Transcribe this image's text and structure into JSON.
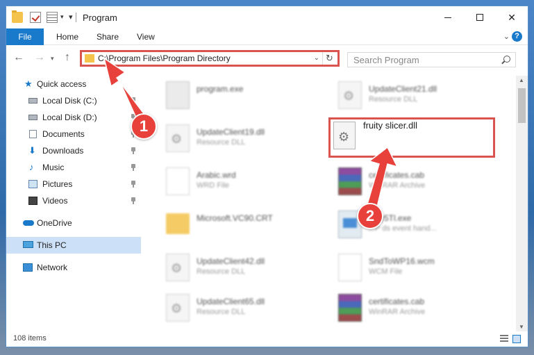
{
  "window": {
    "title": "Program",
    "tabs": {
      "file": "File",
      "home": "Home",
      "share": "Share",
      "view": "View"
    },
    "help": "?",
    "controls": {
      "minimize": "",
      "maximize": "",
      "close": "✕"
    }
  },
  "nav": {
    "address": "C:\\Program Files\\Program Directory",
    "search_placeholder": "Search Program"
  },
  "sidebar": {
    "items": [
      {
        "label": "Quick access",
        "icon": "star-icon",
        "pinned": false
      },
      {
        "label": "Local Disk (C:)",
        "icon": "disk-icon",
        "pinned": true
      },
      {
        "label": "Local Disk (D:)",
        "icon": "disk-icon",
        "pinned": true
      },
      {
        "label": "Documents",
        "icon": "documents-icon",
        "pinned": true
      },
      {
        "label": "Downloads",
        "icon": "download-icon",
        "pinned": true
      },
      {
        "label": "Music",
        "icon": "music-icon",
        "pinned": true
      },
      {
        "label": "Pictures",
        "icon": "pictures-icon",
        "pinned": true
      },
      {
        "label": "Videos",
        "icon": "videos-icon",
        "pinned": true
      },
      {
        "label": "OneDrive",
        "icon": "onedrive-icon",
        "pinned": false
      },
      {
        "label": "This PC",
        "icon": "pc-icon",
        "pinned": false,
        "selected": true
      },
      {
        "label": "Network",
        "icon": "network-icon",
        "pinned": false
      }
    ]
  },
  "files": {
    "left": [
      {
        "name": "program.exe",
        "type": ""
      },
      {
        "name": "UpdateClient19.dll",
        "type": "Resource DLL"
      },
      {
        "name": "Arabic.wrd",
        "type": "WRD File"
      },
      {
        "name": "Microsoft.VC90.CRT",
        "type": ""
      },
      {
        "name": "UpdateClient42.dll",
        "type": "Resource DLL"
      },
      {
        "name": "UpdateClient65.dll",
        "type": "Resource DLL"
      }
    ],
    "right": [
      {
        "name": "UpdateClient21.dll",
        "type": "Resource DLL"
      },
      {
        "name": "fruity slicer.dll",
        "type": ""
      },
      {
        "name": "certificates.cab",
        "type": "WinRAR Archive"
      },
      {
        "name": "...yy5Tl.exe",
        "type": "...P ds event hand..."
      },
      {
        "name": "SndToWP16.wcm",
        "type": "WCM File"
      },
      {
        "name": "certificates.cab",
        "type": "WinRAR Archive"
      }
    ]
  },
  "status": {
    "count": "108 items"
  },
  "annotations": {
    "step1": "1",
    "step2": "2"
  },
  "colors": {
    "accent": "#1979ca",
    "highlight": "#d9534f",
    "annotation": "#e8413b"
  }
}
